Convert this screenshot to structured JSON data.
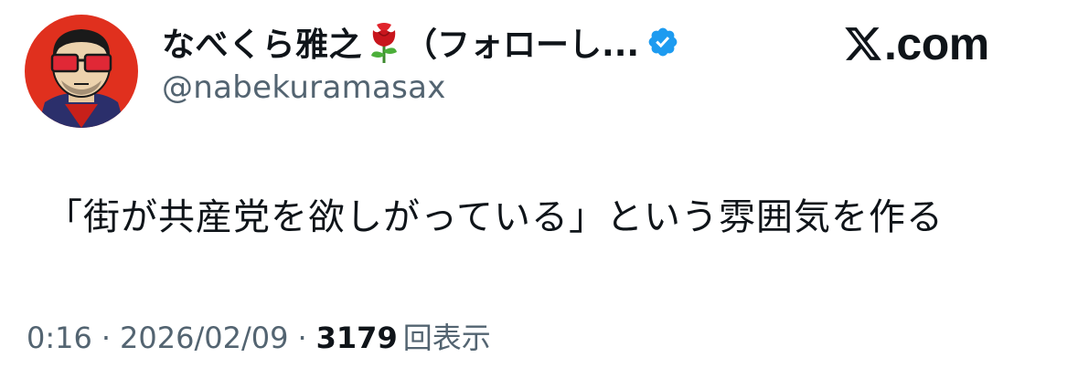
{
  "author": {
    "display_name": "なべくら雅之",
    "name_emoji_icon": "rose-icon",
    "name_suffix": "（フォローし...",
    "verified_icon": "verified-badge-icon",
    "handle": "@nabekuramasax",
    "avatar_icon": "cartoon-man-sunglasses-avatar"
  },
  "brand": {
    "logo_text": ".com",
    "logo_icon": "x-logo-icon"
  },
  "tweet": {
    "text": "「街が共産党を欲しがっている」という雰囲気を作る"
  },
  "meta": {
    "time": "0:16",
    "separator": "·",
    "date": "2026/02/09",
    "views_count": "3179",
    "views_label": "回表示"
  },
  "colors": {
    "text": "#0f1419",
    "secondary": "#536471",
    "verified": "#1d9bf0",
    "avatar_bg": "#e0301e"
  }
}
